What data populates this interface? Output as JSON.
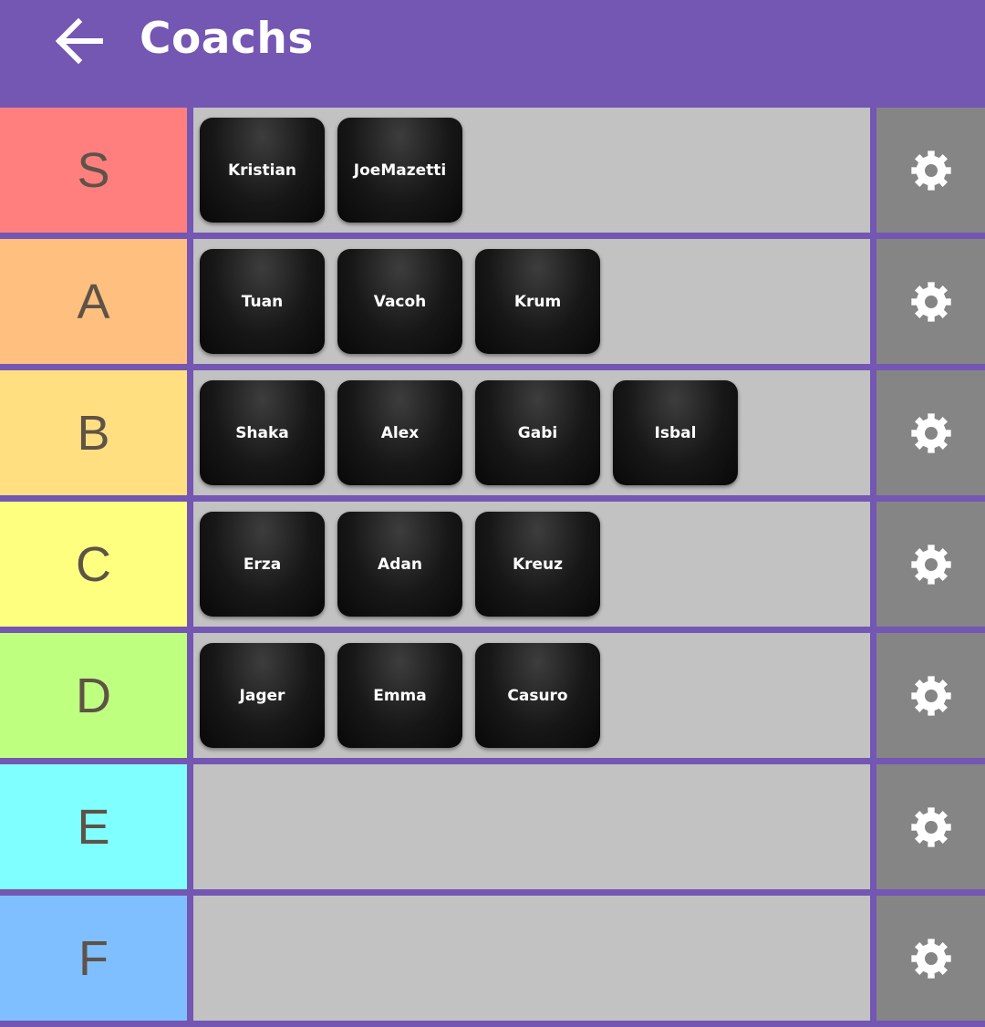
{
  "header": {
    "title": "Coachs",
    "back_icon": "arrow-left-icon"
  },
  "colors": {
    "header_bg": "#7456b3",
    "row_bg": "#c2c2c2",
    "settings_bg": "#858585",
    "card_bg": "#111111"
  },
  "tiers": [
    {
      "label": "S",
      "color": "#ff7f7f",
      "items": [
        "Kristian",
        "JoeMazetti"
      ]
    },
    {
      "label": "A",
      "color": "#ffbf7f",
      "items": [
        "Tuan",
        "Vacoh",
        "Krum"
      ]
    },
    {
      "label": "B",
      "color": "#ffdf80",
      "items": [
        "Shaka",
        "Alex",
        "Gabi",
        "Isbal"
      ]
    },
    {
      "label": "C",
      "color": "#ffff7f",
      "items": [
        "Erza",
        "Adan",
        "Kreuz"
      ]
    },
    {
      "label": "D",
      "color": "#bfff7f",
      "items": [
        "Jager",
        "Emma",
        "Casuro"
      ]
    },
    {
      "label": "E",
      "color": "#7fffff",
      "items": []
    },
    {
      "label": "F",
      "color": "#7fbfff",
      "items": []
    }
  ],
  "settings_icon": "gear-icon"
}
